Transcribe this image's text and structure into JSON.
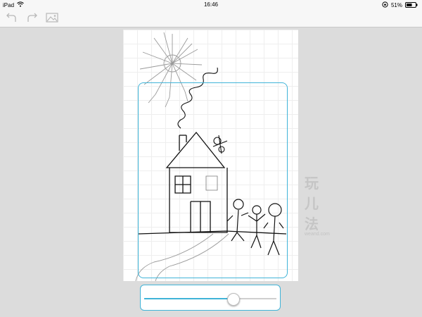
{
  "status_bar": {
    "device": "iPad",
    "time": "16:46",
    "battery": "51%"
  },
  "toolbar": {
    "undo_icon": "undo-icon",
    "redo_icon": "redo-icon",
    "image_icon": "image-icon"
  },
  "watermark": {
    "main": "玩儿法",
    "sub": "weand.com"
  },
  "slider": {
    "value": 0.67
  }
}
